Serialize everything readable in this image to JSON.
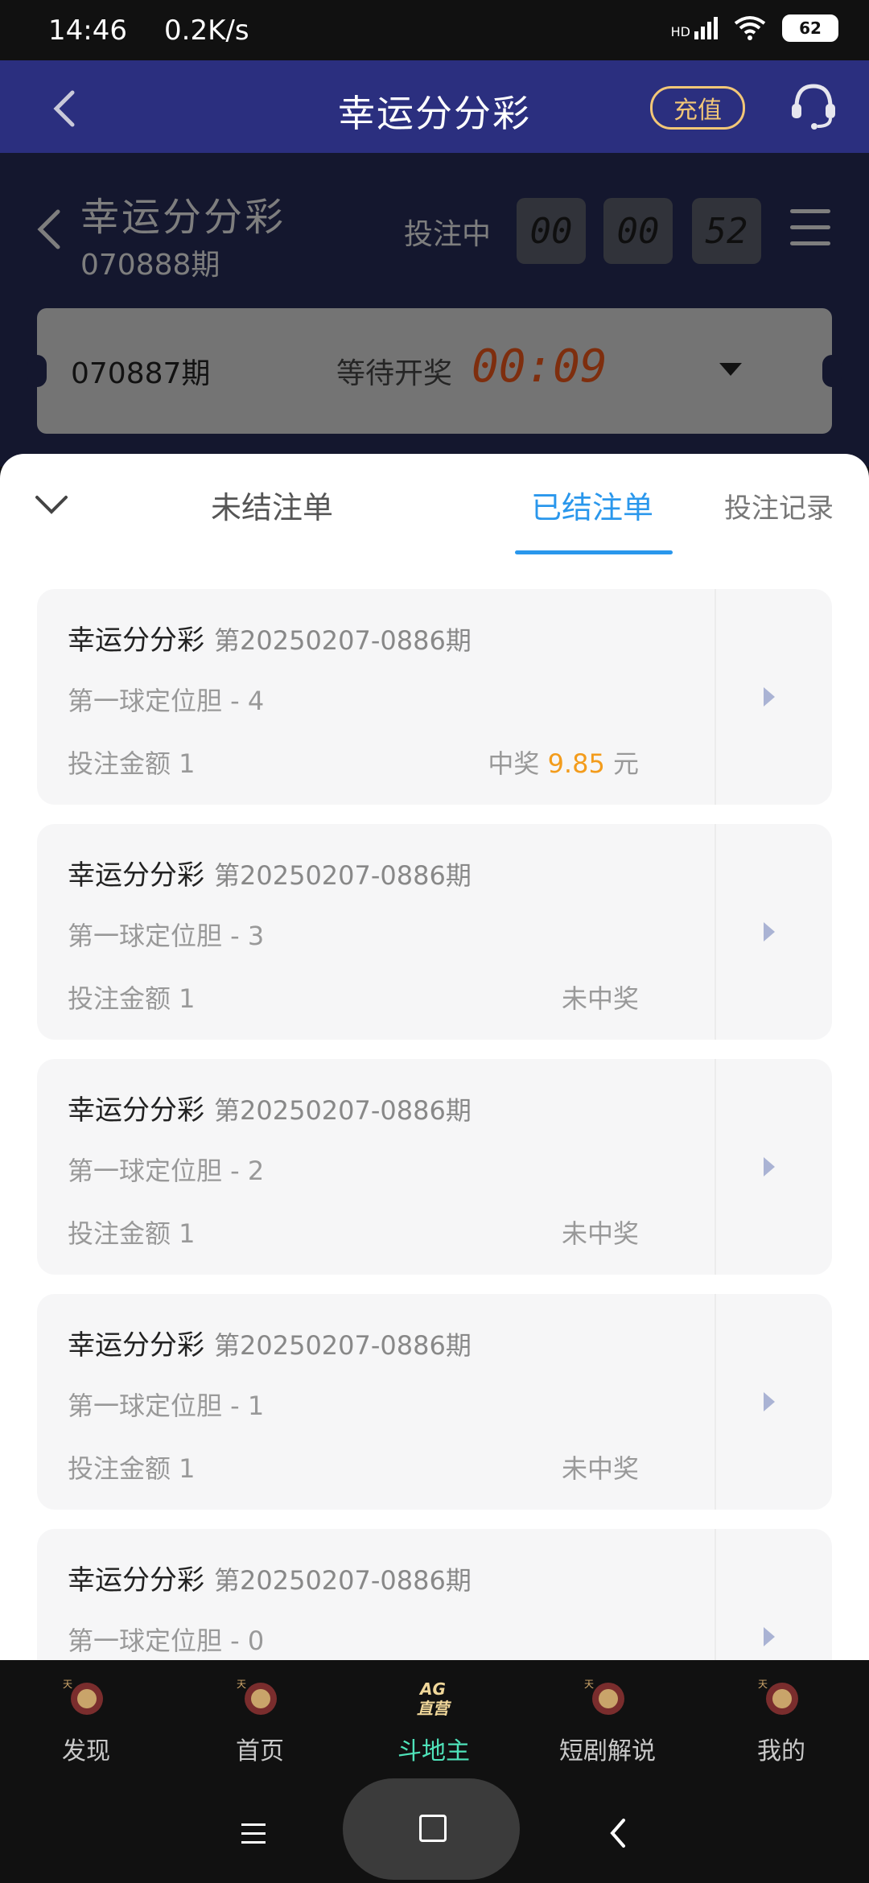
{
  "status_bar": {
    "time": "14:46",
    "net_speed": "0.2K/s",
    "signal": "HD",
    "battery": "62"
  },
  "topnav": {
    "title": "幸运分分彩",
    "recharge_label": "充值",
    "icons": [
      "back-arrow-icon",
      "customer-service-icon"
    ]
  },
  "game": {
    "title": "幸运分分彩",
    "period": "070888期",
    "betting_label": "投注中",
    "countdown": [
      "00",
      "00",
      "52"
    ],
    "last_draw": {
      "period": "070887期",
      "status": "等待开奖",
      "countdown": "00:09"
    }
  },
  "sheet": {
    "tabs": [
      {
        "label": "未结注单",
        "active": false
      },
      {
        "label": "已结注单",
        "active": true
      },
      {
        "label": "投注记录",
        "active": false
      }
    ],
    "cards": [
      {
        "title": "幸运分分彩",
        "period": "第20250207-0886期",
        "position": "第一球定位胆 - 4",
        "amount": "投注金额 1",
        "result_prefix": "中奖",
        "result_amount": "9.85",
        "result_suffix": "元",
        "won": true
      },
      {
        "title": "幸运分分彩",
        "period": "第20250207-0886期",
        "position": "第一球定位胆 - 3",
        "amount": "投注金额 1",
        "result": "未中奖",
        "won": false
      },
      {
        "title": "幸运分分彩",
        "period": "第20250207-0886期",
        "position": "第一球定位胆 - 2",
        "amount": "投注金额 1",
        "result": "未中奖",
        "won": false
      },
      {
        "title": "幸运分分彩",
        "period": "第20250207-0886期",
        "position": "第一球定位胆 - 1",
        "amount": "投注金额 1",
        "result": "未中奖",
        "won": false
      },
      {
        "title": "幸运分分彩",
        "period": "第20250207-0886期",
        "position": "第一球定位胆 - 0",
        "amount": "",
        "result": "",
        "won": false
      }
    ]
  },
  "tabbar": {
    "items": [
      {
        "label": "发现",
        "icon": "discover-icon",
        "active": false
      },
      {
        "label": "首页",
        "icon": "home-icon",
        "active": false
      },
      {
        "label": "斗地主",
        "icon": "ag-live-icon",
        "badge_text": "AG 直营",
        "active": true
      },
      {
        "label": "短剧解说",
        "icon": "drama-icon",
        "active": false
      },
      {
        "label": "我的",
        "icon": "profile-icon",
        "active": false
      }
    ]
  },
  "colors": {
    "nav_bg": "#2b2f7f",
    "accent_blue": "#2a97ec",
    "gold": "#f2c777",
    "win_orange": "#f39c1c",
    "countdown_red": "#e5541b",
    "active_tab": "#4fe3ba"
  }
}
